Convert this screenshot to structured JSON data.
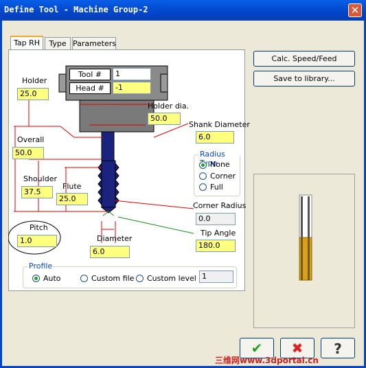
{
  "window": {
    "title": "Define Tool - Machine Group-2",
    "close": "✕"
  },
  "tabs": [
    {
      "label": "Tap RH"
    },
    {
      "label": "Type"
    },
    {
      "label": "Parameters"
    }
  ],
  "holder_header": {
    "tool_label": "Tool #",
    "tool_value": "1",
    "head_label": "Head #",
    "head_value": "-1"
  },
  "fields": {
    "holder": {
      "label": "Holder",
      "value": "25.0"
    },
    "holder_dia": {
      "label": "Holder dia.",
      "value": "50.0"
    },
    "shank_diameter": {
      "label": "Shank Diameter",
      "value": "6.0"
    },
    "overall": {
      "label": "Overall",
      "value": "50.0"
    },
    "shoulder": {
      "label": "Shoulder",
      "value": "37.5"
    },
    "flute": {
      "label": "Flute",
      "value": "25.0"
    },
    "pitch": {
      "label": "Pitch",
      "value": "1.0"
    },
    "corner_radius": {
      "label": "Corner Radius",
      "value": "0.0"
    },
    "tip_angle": {
      "label": "Tip Angle",
      "value": "180.0"
    },
    "diameter": {
      "label": "Diameter",
      "value": "6.0"
    }
  },
  "radius_type": {
    "legend": "Radius Type",
    "options": [
      "None",
      "Corner",
      "Full"
    ],
    "selected": "None"
  },
  "profile": {
    "legend": "Profile",
    "options": [
      "Auto",
      "Custom file",
      "Custom level"
    ],
    "selected": "Auto",
    "level_value": "1"
  },
  "buttons": {
    "calc": "Calc. Speed/Feed",
    "save": "Save to library..."
  },
  "bottom_buttons": {
    "ok": "✔",
    "cancel": "✖",
    "help": "?"
  },
  "watermark": "三维网www.3dportal.cn",
  "colors": {
    "title_bar": "#0045c9",
    "dimension_line": "#e00000",
    "field_bg": "#ffff80",
    "radio_accent": "#21a121",
    "legend_text": "#0046d5"
  }
}
